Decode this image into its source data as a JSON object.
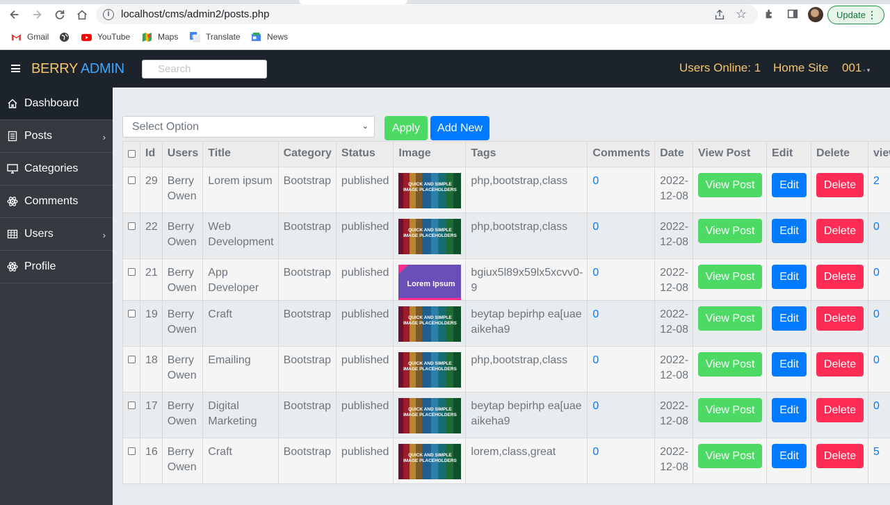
{
  "browser": {
    "url": "localhost/cms/admin2/posts.php",
    "update_label": "Update",
    "bookmarks": [
      {
        "label": "Gmail"
      },
      {
        "label": ""
      },
      {
        "label": "YouTube"
      },
      {
        "label": "Maps"
      },
      {
        "label": "Translate"
      },
      {
        "label": "News"
      }
    ]
  },
  "navbar": {
    "brand_part1": "BERRY",
    "brand_part2": "ADMIN",
    "search_placeholder": "Search",
    "users_online": "Users Online: 1",
    "home_site": "Home Site",
    "user": "001"
  },
  "sidebar": {
    "items": [
      {
        "label": "Dashboard",
        "icon": "home-icon"
      },
      {
        "label": "Posts",
        "icon": "document-icon"
      },
      {
        "label": "Categories",
        "icon": "desktop-icon"
      },
      {
        "label": "Comments",
        "icon": "atom-icon"
      },
      {
        "label": "Users",
        "icon": "table-icon"
      },
      {
        "label": "Profile",
        "icon": "atom-icon"
      }
    ]
  },
  "toolbar": {
    "select_label": "Select Option",
    "apply_label": "Apply",
    "add_new_label": "Add New"
  },
  "table": {
    "headers": [
      "Id",
      "Users",
      "Title",
      "Category",
      "Status",
      "Image",
      "Tags",
      "Comments",
      "Date",
      "View Post",
      "Edit",
      "Delete",
      "view"
    ],
    "rows": [
      {
        "id": "29",
        "user1": "Berry",
        "user2": "Owen",
        "title1": "Lorem ipsum",
        "title2": "",
        "category": "Bootstrap",
        "status": "published",
        "image": "quick-simple",
        "tags1": "php,bootstrap,class",
        "tags2": "",
        "comments": "0",
        "date1": "2022-",
        "date2": "12-08",
        "view_post": "View Post",
        "edit": "Edit",
        "delete": "Delete",
        "views": "2"
      },
      {
        "id": "22",
        "user1": "Berry",
        "user2": "Owen",
        "title1": "Web",
        "title2": "Development",
        "category": "Bootstrap",
        "status": "published",
        "image": "quick-simple",
        "tags1": "php,bootstrap,class",
        "tags2": "",
        "comments": "0",
        "date1": "2022-",
        "date2": "12-08",
        "view_post": "View Post",
        "edit": "Edit",
        "delete": "Delete",
        "views": "0"
      },
      {
        "id": "21",
        "user1": "Berry",
        "user2": "Owen",
        "title1": "App",
        "title2": "Developer",
        "category": "Bootstrap",
        "status": "published",
        "image": "lorem-ipsum",
        "tags1": "bgiux5l89x59lx5xcvv0-",
        "tags2": "9",
        "comments": "0",
        "date1": "2022-",
        "date2": "12-08",
        "view_post": "View Post",
        "edit": "Edit",
        "delete": "Delete",
        "views": "0"
      },
      {
        "id": "19",
        "user1": "Berry",
        "user2": "Owen",
        "title1": "Craft",
        "title2": "",
        "category": "Bootstrap",
        "status": "published",
        "image": "quick-simple",
        "tags1": "beytap bepirhp ea[uae",
        "tags2": "aikeha9",
        "comments": "0",
        "date1": "2022-",
        "date2": "12-08",
        "view_post": "View Post",
        "edit": "Edit",
        "delete": "Delete",
        "views": "0"
      },
      {
        "id": "18",
        "user1": "Berry",
        "user2": "Owen",
        "title1": "Emailing",
        "title2": "",
        "category": "Bootstrap",
        "status": "published",
        "image": "quick-simple",
        "tags1": "php,bootstrap,class",
        "tags2": "",
        "comments": "0",
        "date1": "2022-",
        "date2": "12-08",
        "view_post": "View Post",
        "edit": "Edit",
        "delete": "Delete",
        "views": "0"
      },
      {
        "id": "17",
        "user1": "Berry",
        "user2": "Owen",
        "title1": "Digital",
        "title2": "Marketing",
        "category": "Bootstrap",
        "status": "published",
        "image": "quick-simple",
        "tags1": "beytap bepirhp ea[uae",
        "tags2": "aikeha9",
        "comments": "0",
        "date1": "2022-",
        "date2": "12-08",
        "view_post": "View Post",
        "edit": "Edit",
        "delete": "Delete",
        "views": "0"
      },
      {
        "id": "16",
        "user1": "Berry",
        "user2": "Owen",
        "title1": "Craft",
        "title2": "",
        "category": "Bootstrap",
        "status": "published",
        "image": "quick-simple",
        "tags1": "lorem,class,great",
        "tags2": "",
        "comments": "0",
        "date1": "2022-",
        "date2": "12-08",
        "view_post": "View Post",
        "edit": "Edit",
        "delete": "Delete",
        "views": "5"
      }
    ]
  },
  "thumbnails": {
    "quick_simple_line1": "QUICK AND SIMPLE",
    "quick_simple_line2": "IMAGE PLACEHOLDERS",
    "lorem_ipsum": "Lorem Ipsum"
  },
  "colors": {
    "navbar_bg": "#1c232b",
    "sidebar_bg": "#343a40",
    "brand_gold": "#f5c56b",
    "brand_blue": "#3aa8ff",
    "success": "#4cd964",
    "primary": "#007bff",
    "danger": "#ff2d55"
  }
}
